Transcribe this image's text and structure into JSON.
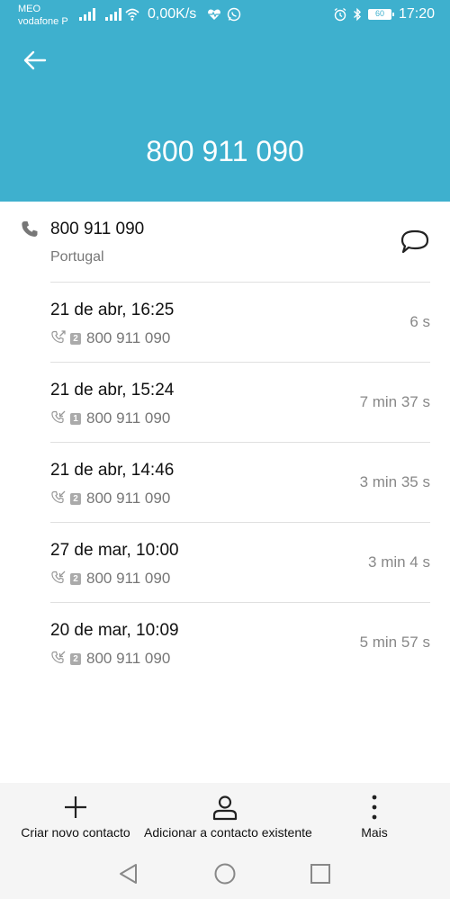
{
  "status_bar": {
    "carrier1": "MEO",
    "carrier2": "vodafone P",
    "speed": "0,00K/s",
    "battery": "60",
    "time": "17:20",
    "icons": [
      "signal-icon",
      "signal-icon",
      "wifi-icon",
      "heart-rate-icon",
      "whatsapp-icon",
      "alarm-icon",
      "bluetooth-icon",
      "battery-icon"
    ]
  },
  "header": {
    "title": "800 911 090",
    "back_icon": "arrow-left-icon",
    "color": "#3eb0ce"
  },
  "contact": {
    "number": "800 911 090",
    "country": "Portugal",
    "phone_icon": "phone-icon",
    "message_icon": "message-bubble-icon"
  },
  "calls": [
    {
      "date": "21 de abr, 16:25",
      "sim": "2",
      "number": "800 911 090",
      "duration": "6 s",
      "type_icon": "outgoing-call-icon"
    },
    {
      "date": "21 de abr, 15:24",
      "sim": "1",
      "number": "800 911 090",
      "duration": "7 min 37 s",
      "type_icon": "incoming-call-icon"
    },
    {
      "date": "21 de abr, 14:46",
      "sim": "2",
      "number": "800 911 090",
      "duration": "3 min 35 s",
      "type_icon": "incoming-call-icon"
    },
    {
      "date": "27 de mar, 10:00",
      "sim": "2",
      "number": "800 911 090",
      "duration": "3 min 4 s",
      "type_icon": "incoming-call-icon"
    },
    {
      "date": "20 de mar, 10:09",
      "sim": "2",
      "number": "800 911 090",
      "duration": "5 min 57 s",
      "type_icon": "incoming-call-icon"
    }
  ],
  "actions": {
    "create": "Criar novo contacto",
    "add_existing": "Adicionar a contacto existente",
    "more": "Mais"
  },
  "navbar": {
    "back": "nav-back-icon",
    "home": "nav-home-icon",
    "recents": "nav-recents-icon"
  }
}
